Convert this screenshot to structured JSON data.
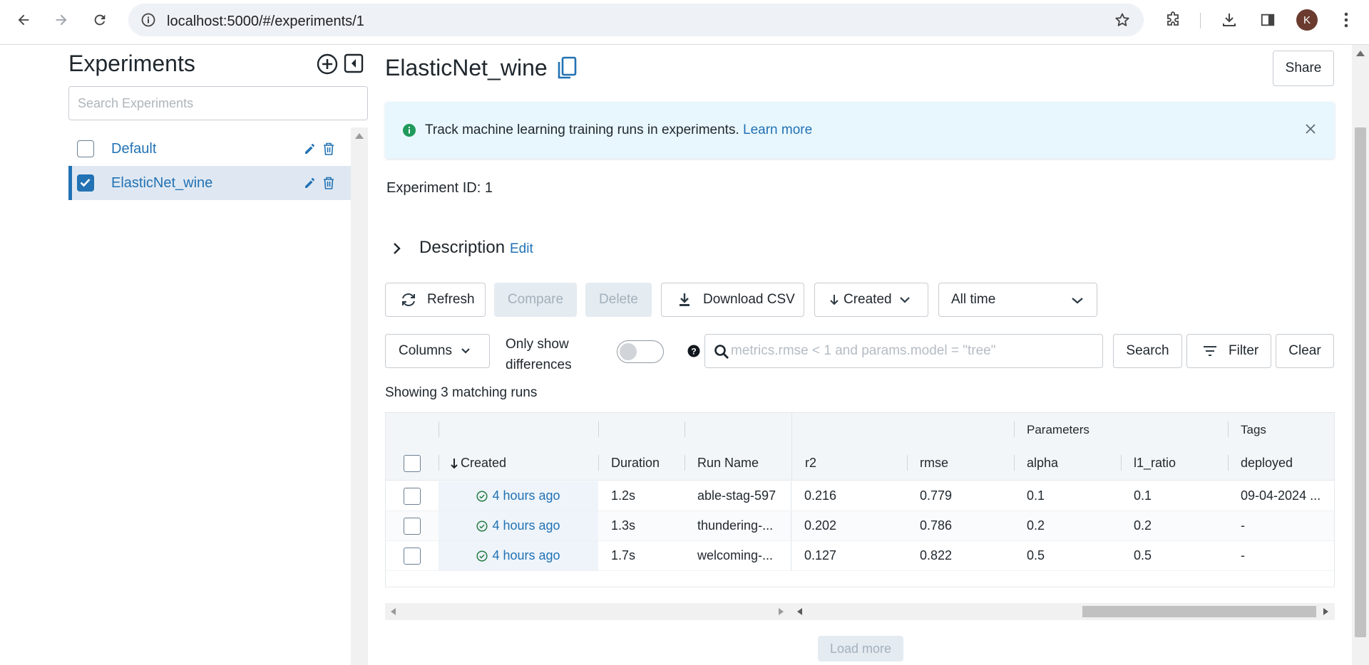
{
  "browser": {
    "url": "localhost:5000/#/experiments/1",
    "profile_initial": "K"
  },
  "sidebar": {
    "title": "Experiments",
    "search_placeholder": "Search Experiments",
    "items": [
      {
        "label": "Default",
        "checked": false
      },
      {
        "label": "ElasticNet_wine",
        "checked": true
      }
    ]
  },
  "header": {
    "title": "ElasticNet_wine",
    "share_label": "Share"
  },
  "banner": {
    "text": "Track machine learning training runs in experiments.",
    "link": "Learn more"
  },
  "experiment": {
    "id_label": "Experiment ID:",
    "id_value": "1",
    "description_label": "Description",
    "edit_label": "Edit"
  },
  "toolbar": {
    "refresh": "Refresh",
    "compare": "Compare",
    "delete": "Delete",
    "download_csv": "Download CSV",
    "sort": "Created",
    "time_range": "All time",
    "columns": "Columns",
    "only_show_line1": "Only show",
    "only_show_line2": "differences",
    "search_placeholder": "metrics.rmse < 1 and params.model = \"tree\"",
    "search": "Search",
    "filter": "Filter",
    "clear": "Clear"
  },
  "runs": {
    "showing": "Showing 3 matching runs",
    "group_headers": {
      "parameters": "Parameters",
      "tags": "Tags"
    },
    "columns": {
      "created": "Created",
      "duration": "Duration",
      "run_name": "Run Name",
      "r2": "r2",
      "rmse": "rmse",
      "alpha": "alpha",
      "l1_ratio": "l1_ratio",
      "deployed": "deployed"
    },
    "rows": [
      {
        "created": "4 hours ago",
        "duration": "1.2s",
        "run_name": "able-stag-597",
        "r2": "0.216",
        "rmse": "0.779",
        "alpha": "0.1",
        "l1_ratio": "0.1",
        "deployed": "09-04-2024 ..."
      },
      {
        "created": "4 hours ago",
        "duration": "1.3s",
        "run_name": "thundering-...",
        "r2": "0.202",
        "rmse": "0.786",
        "alpha": "0.2",
        "l1_ratio": "0.2",
        "deployed": "-"
      },
      {
        "created": "4 hours ago",
        "duration": "1.7s",
        "run_name": "welcoming-...",
        "r2": "0.127",
        "rmse": "0.822",
        "alpha": "0.5",
        "l1_ratio": "0.5",
        "deployed": "-"
      }
    ],
    "load_more": "Load more"
  },
  "colors": {
    "accent": "#2272b4",
    "success": "#277c43",
    "banner_bg": "#e8f7fd"
  }
}
